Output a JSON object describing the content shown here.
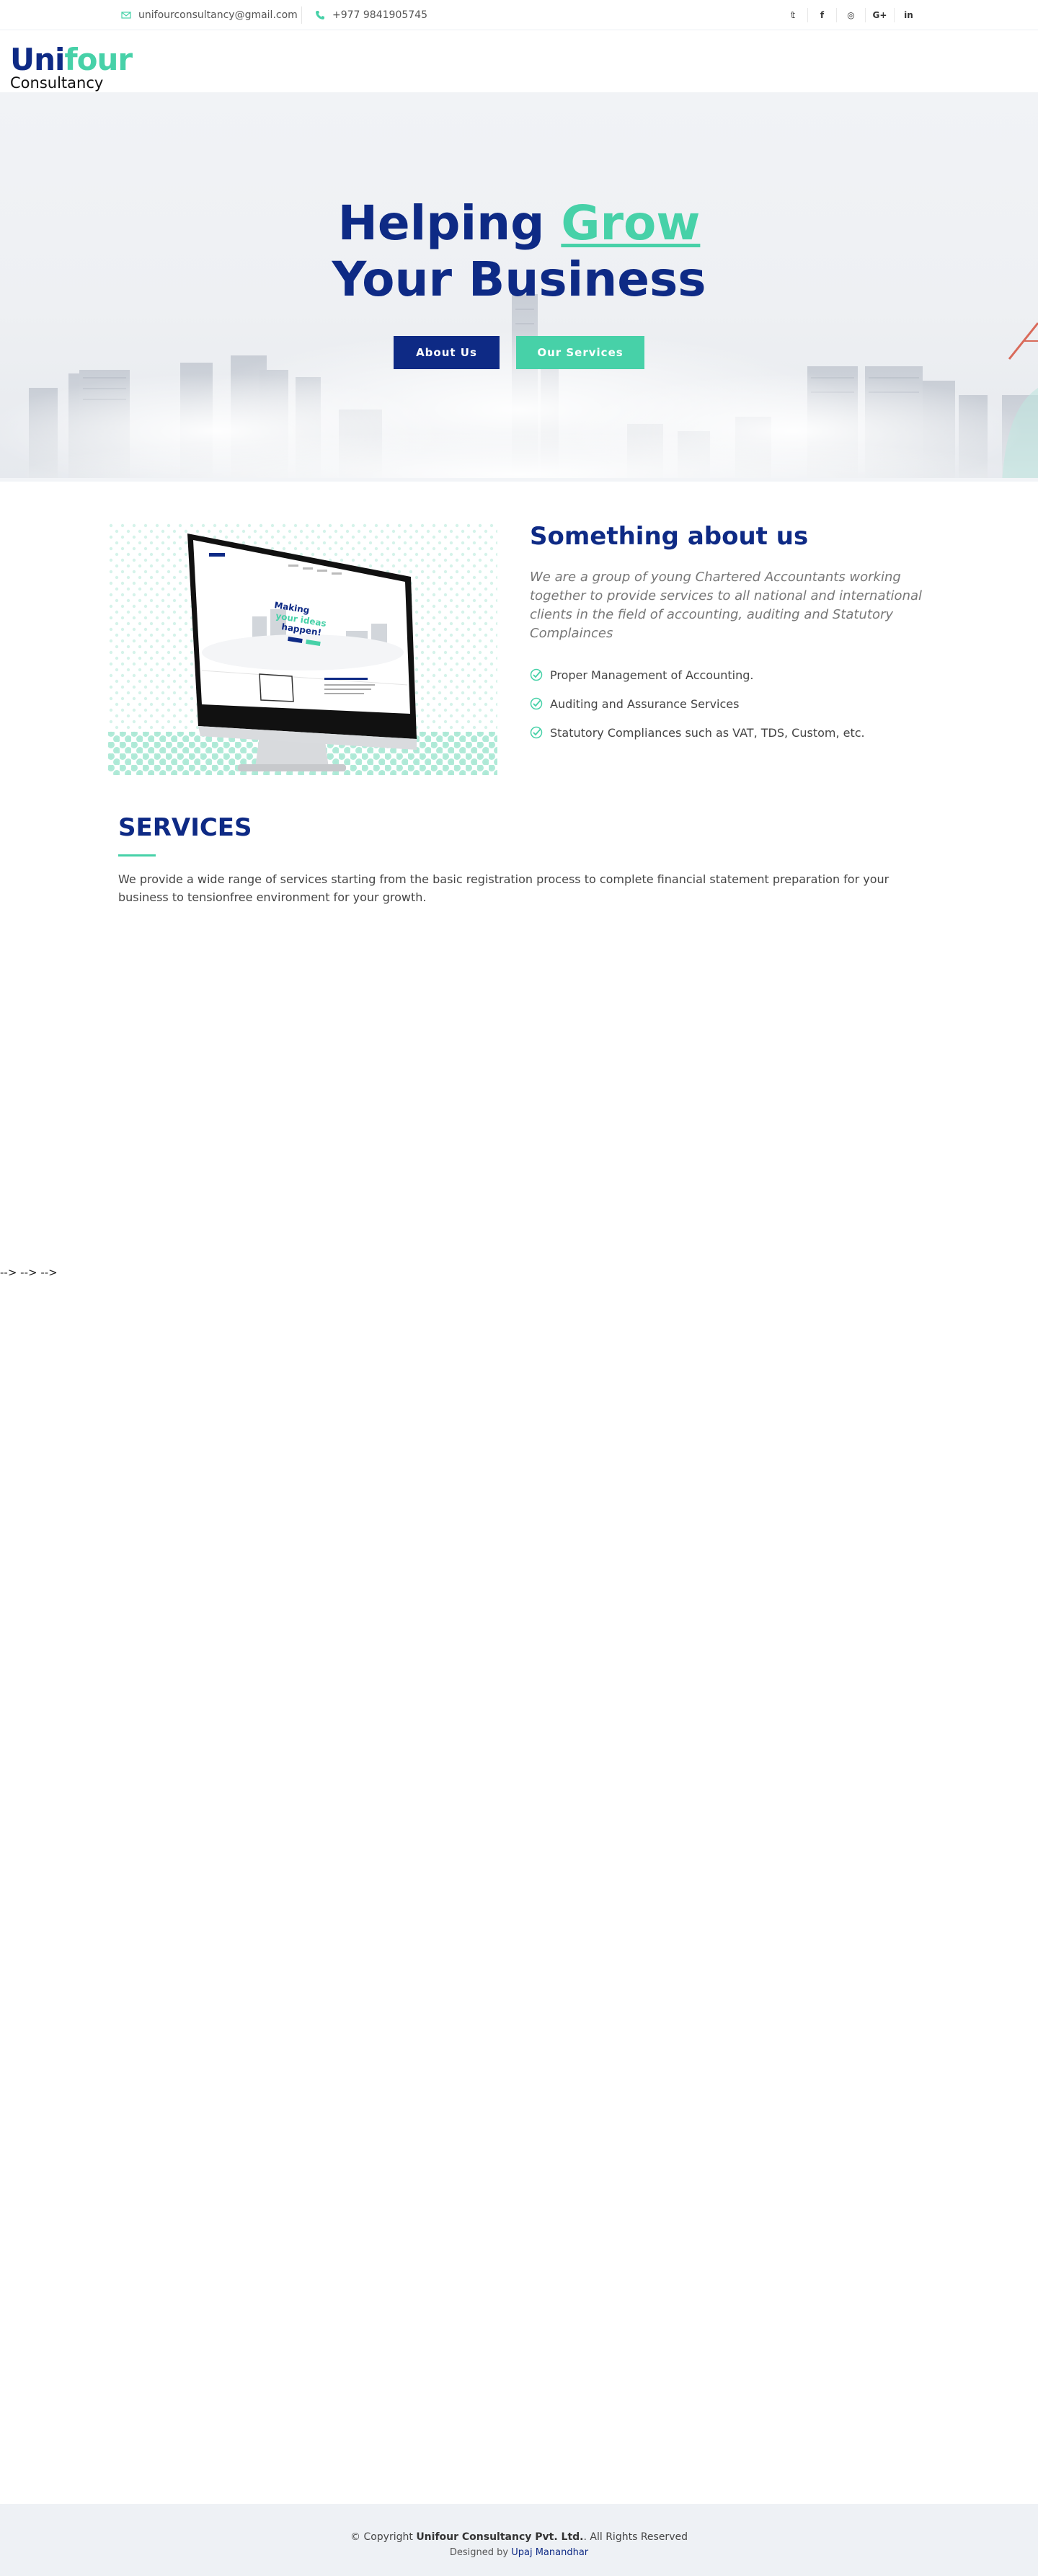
{
  "topbar": {
    "email": "unifourconsultancy@gmail.com",
    "phone": "+977 9841905745",
    "social": [
      "twitter-icon",
      "facebook-icon",
      "instagram-icon",
      "google-plus-icon",
      "linkedin-icon"
    ],
    "social_glyphs": [
      "𝕥",
      "f",
      "◎",
      "G+",
      "in"
    ]
  },
  "logo": {
    "uni": "Uni",
    "four": "four",
    "sub": "Consultancy"
  },
  "hero": {
    "line1_prefix": "Helping ",
    "line1_highlight": "Grow",
    "line2": "Your Business",
    "about_button": "About Us",
    "services_button": "Our Services"
  },
  "about": {
    "title": "Something about us",
    "description": "We are a group of young Chartered Accountants working together to provide services to all national and international clients in the field of accounting, auditing and Statutory Complainces",
    "points": [
      "Proper Management of Accounting.",
      "Auditing and Assurance Services",
      "Statutory Compliances such as VAT, TDS, Custom, etc."
    ],
    "image_text": {
      "line1": "Making",
      "line2": "your ideas",
      "line3": "happen!"
    }
  },
  "services": {
    "title": "SERVICES",
    "description": "We provide a wide range of services starting from the basic registration process to complete financial statement preparation for your business to tensionfree environment for your growth."
  },
  "stray_text": "--> --> -->",
  "footer": {
    "copyright_prefix": "© Copyright ",
    "company": "Unifour Consultancy Pvt. Ltd.",
    "copyright_suffix": ". All Rights Reserved",
    "designed_by": "Designed by ",
    "designer": "Upaj Manandhar"
  },
  "colors": {
    "brand_blue": "#0e2a85",
    "accent_green": "#47d1a8"
  }
}
